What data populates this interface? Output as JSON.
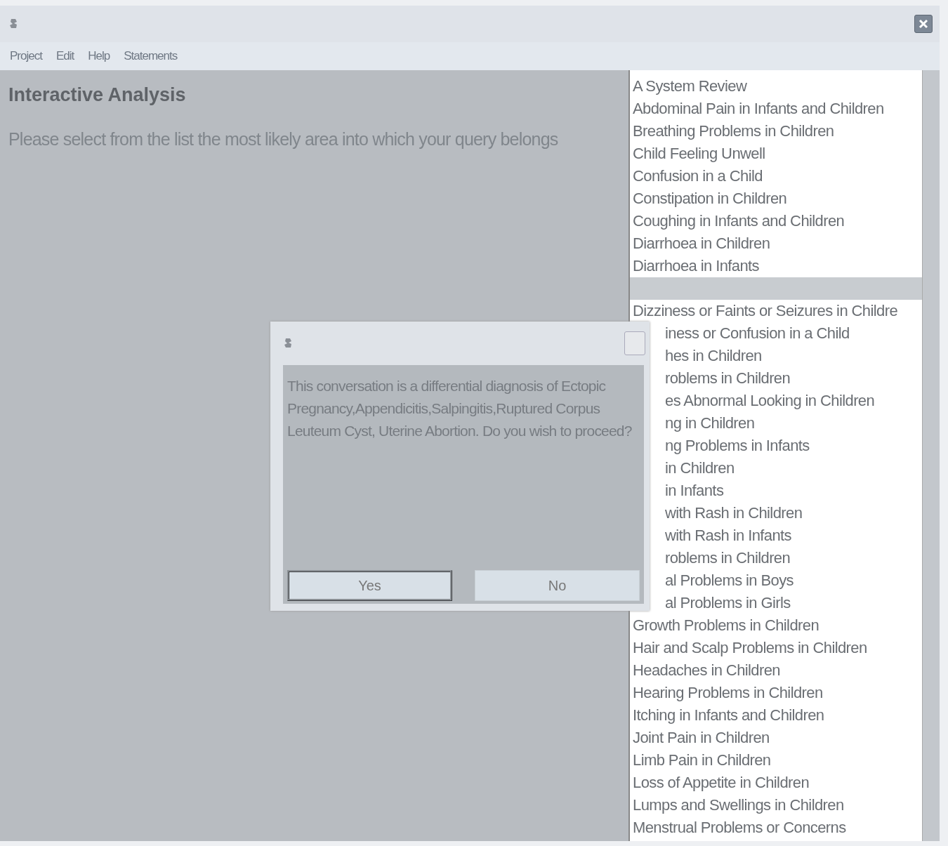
{
  "menu": [
    {
      "label": "Project"
    },
    {
      "label": "Edit"
    },
    {
      "label": "Help"
    },
    {
      "label": "Statements"
    }
  ],
  "main": {
    "heading": "Interactive Analysis",
    "instruction": "Please select from the list the most likely area into which your query belongs"
  },
  "list": {
    "items": [
      {
        "label": "A System Review",
        "kind": "item"
      },
      {
        "label": "Abdominal Pain in Infants and Children",
        "kind": "item"
      },
      {
        "label": "Breathing Problems in Children",
        "kind": "item"
      },
      {
        "label": "Child Feeling Unwell",
        "kind": "item"
      },
      {
        "label": "Confusion in a Child",
        "kind": "item"
      },
      {
        "label": "Constipation in Children",
        "kind": "item"
      },
      {
        "label": "Coughing in Infants and Children",
        "kind": "item"
      },
      {
        "label": "Diarrhoea in Children",
        "kind": "item"
      },
      {
        "label": "Diarrhoea in Infants",
        "kind": "item"
      },
      {
        "kind": "gap"
      },
      {
        "label": "Dizziness or Faints or Seizures in Childre",
        "kind": "item"
      },
      {
        "label": "iness or Confusion in a Child",
        "kind": "covered"
      },
      {
        "label": "hes in Children",
        "kind": "covered"
      },
      {
        "label": "roblems in Children",
        "kind": "covered"
      },
      {
        "label": "es Abnormal Looking in Children",
        "kind": "covered"
      },
      {
        "label": "ng in Children",
        "kind": "covered"
      },
      {
        "label": "ng Problems in Infants",
        "kind": "covered"
      },
      {
        "label": "in Children",
        "kind": "covered"
      },
      {
        "label": "in Infants",
        "kind": "covered"
      },
      {
        "label": "with Rash in Children",
        "kind": "covered"
      },
      {
        "label": "with Rash in Infants",
        "kind": "covered"
      },
      {
        "label": "roblems in Children",
        "kind": "covered"
      },
      {
        "label": "al Problems in Boys",
        "kind": "covered"
      },
      {
        "label": "al Problems in Girls",
        "kind": "covered"
      },
      {
        "label": "Growth Problems in Children",
        "kind": "item"
      },
      {
        "label": "Hair and Scalp Problems in Children",
        "kind": "item"
      },
      {
        "label": "Headaches in Children",
        "kind": "item"
      },
      {
        "label": "Hearing Problems in Children",
        "kind": "item"
      },
      {
        "label": "Itching in Infants and Children",
        "kind": "item"
      },
      {
        "label": "Joint Pain in Children",
        "kind": "item"
      },
      {
        "label": "Limb Pain in Children",
        "kind": "item"
      },
      {
        "label": "Loss of Appetite in Children",
        "kind": "item"
      },
      {
        "label": "Lumps and Swellings in Children",
        "kind": "item"
      },
      {
        "label": "Menstrual Problems or Concerns",
        "kind": "item"
      }
    ]
  },
  "dialog": {
    "message": "This conversation is a differential diagnosis of Ectopic Pregnancy,Appendicitis,Salpingitis,Ruptured Corpus Leuteum Cyst, Uterine Abortion. Do you wish to proceed?",
    "buttons": [
      {
        "label": "Yes",
        "selected": true
      },
      {
        "label": "No",
        "selected": false
      }
    ]
  }
}
